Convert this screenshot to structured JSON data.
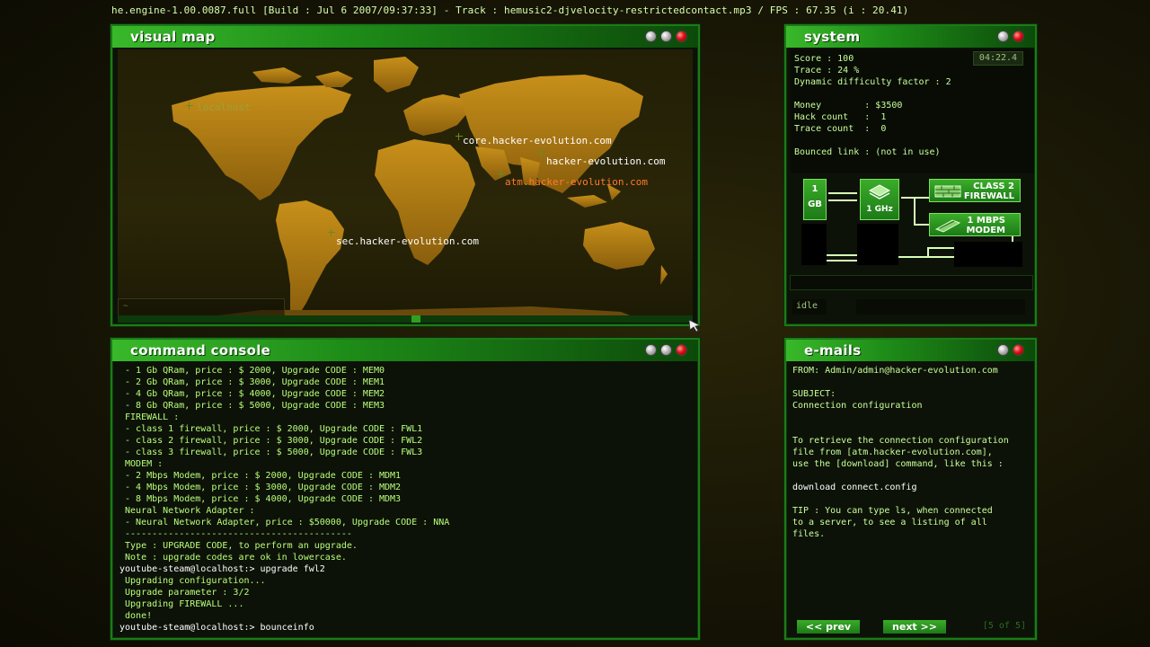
{
  "status_bar": "he.engine-1.00.0087.full [Build : Jul  6 2007/09:37:33] - Track : hemusic2-djvelocity-restrictedcontact.mp3 / FPS : 67.35 (i : 20.41)",
  "colors": {
    "panel_header": "#39b82a",
    "background": "#1b1907",
    "console_text": "#b8ff7a",
    "highlight_host": "#ff7a2a"
  },
  "visual_map": {
    "title": "visual map",
    "hosts": [
      {
        "name": "localhost",
        "type": "local"
      },
      {
        "name": "core.hacker-evolution.com",
        "type": "normal"
      },
      {
        "name": "hacker-evolution.com",
        "type": "normal"
      },
      {
        "name": "atm.hacker-evolution.com",
        "type": "highlight"
      },
      {
        "name": "sec.hacker-evolution.com",
        "type": "normal"
      }
    ],
    "corner_label": "~"
  },
  "command_console": {
    "title": "command console",
    "lines": [
      {
        "text": " - 1 Gb QRam, price : $ 2000, Upgrade CODE : MEM0",
        "type": "output"
      },
      {
        "text": " - 2 Gb QRam, price : $ 3000, Upgrade CODE : MEM1",
        "type": "output"
      },
      {
        "text": " - 4 Gb QRam, price : $ 4000, Upgrade CODE : MEM2",
        "type": "output"
      },
      {
        "text": " - 8 Gb QRam, price : $ 5000, Upgrade CODE : MEM3",
        "type": "output"
      },
      {
        "text": " FIREWALL :",
        "type": "output"
      },
      {
        "text": " - class 1 firewall, price : $ 2000, Upgrade CODE : FWL1",
        "type": "output"
      },
      {
        "text": " - class 2 firewall, price : $ 3000, Upgrade CODE : FWL2",
        "type": "output"
      },
      {
        "text": " - class 3 firewall, price : $ 5000, Upgrade CODE : FWL3",
        "type": "output"
      },
      {
        "text": " MODEM :",
        "type": "output"
      },
      {
        "text": " - 2 Mbps Modem, price : $ 2000, Upgrade CODE : MDM1",
        "type": "output"
      },
      {
        "text": " - 4 Mbps Modem, price : $ 3000, Upgrade CODE : MDM2",
        "type": "output"
      },
      {
        "text": " - 8 Mbps Modem, price : $ 4000, Upgrade CODE : MDM3",
        "type": "output"
      },
      {
        "text": " Neural Network Adapter :",
        "type": "output"
      },
      {
        "text": " - Neural Network Adapter, price : $50000, Upgrade CODE : NNA",
        "type": "output"
      },
      {
        "text": " ------------------------------------------",
        "type": "output"
      },
      {
        "text": " Type : UPGRADE CODE, to perform an upgrade.",
        "type": "output"
      },
      {
        "text": " Note : upgrade codes are ok in lowercase.",
        "type": "output"
      },
      {
        "text": "youtube-steam@localhost:> upgrade fwl2",
        "type": "prompt"
      },
      {
        "text": " Upgrading configuration...",
        "type": "output"
      },
      {
        "text": " Upgrade parameter : 3/2",
        "type": "output"
      },
      {
        "text": " Upgrading FIREWALL ...",
        "type": "output"
      },
      {
        "text": " done!",
        "type": "output"
      },
      {
        "text": "youtube-steam@localhost:> bounceinfo",
        "type": "prompt"
      }
    ]
  },
  "system": {
    "title": "system",
    "timer": "04:22.4",
    "info_lines": [
      "Score : 100",
      "Trace : 24 %",
      "Dynamic difficulty factor : 2",
      "",
      "Money        : $3500",
      "Hack count   :  1",
      "Trace count  :  0",
      "",
      "Bounced link : (not in use)"
    ],
    "hardware": {
      "memory_line1": "1",
      "memory_line2": "GB",
      "cpu": "1 GHz",
      "firewall_line1": "CLASS 2",
      "firewall_line2": "FIREWALL",
      "modem_line1": "1 MBPS",
      "modem_line2": "MODEM"
    },
    "status": "idle"
  },
  "emails": {
    "title": "e-mails",
    "lines": [
      {
        "text": "FROM: Admin/admin@hacker-evolution.com",
        "style": "normal"
      },
      {
        "text": "",
        "style": "normal"
      },
      {
        "text": "SUBJECT:",
        "style": "normal"
      },
      {
        "text": "Connection configuration",
        "style": "normal"
      },
      {
        "text": "",
        "style": "normal"
      },
      {
        "text": "",
        "style": "normal"
      },
      {
        "text": "To retrieve the connection configuration",
        "style": "normal"
      },
      {
        "text": "file from [atm.hacker-evolution.com],",
        "style": "normal"
      },
      {
        "text": "use the [download] command, like this :",
        "style": "normal"
      },
      {
        "text": "",
        "style": "normal"
      },
      {
        "text": "download connect.config",
        "style": "white"
      },
      {
        "text": "",
        "style": "normal"
      },
      {
        "text": "TIP : You can type ls, when connected",
        "style": "normal"
      },
      {
        "text": "to a server, to see a listing of all",
        "style": "normal"
      },
      {
        "text": "files.",
        "style": "normal"
      }
    ],
    "prev_label": "<< prev",
    "next_label": "next >>",
    "page_label": "[5 of 5]"
  }
}
